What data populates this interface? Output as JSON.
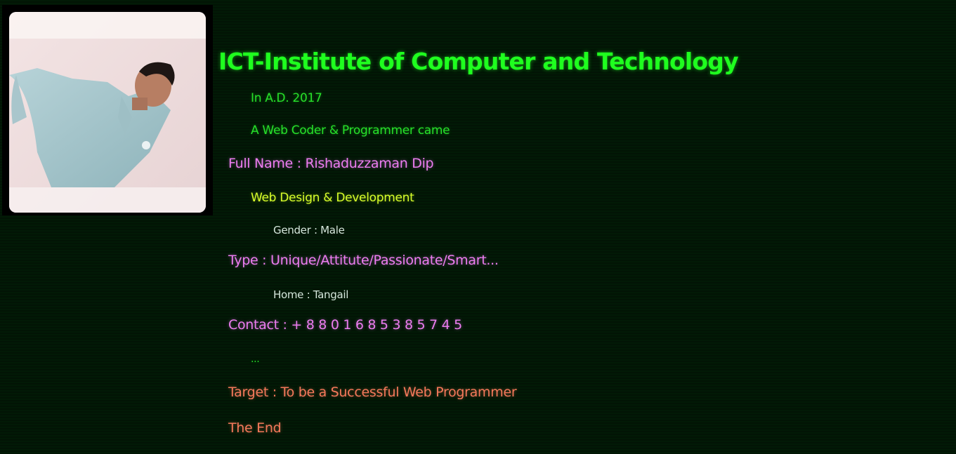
{
  "profile": {
    "photo_icon": "person-portrait-photo",
    "title": "ICT-Institute of Computer and Technology",
    "year_line": "In A.D. 2017",
    "intro_line": "A Web Coder & Programmer came",
    "full_name": "Full Name : Rishaduzzaman Dip",
    "profession": "Web Design & Development",
    "gender": "Gender : Male",
    "type": "Type : Unique/Attitute/Passionate/Smart...",
    "home": "Home : Tangail",
    "contact": "Contact : + 8 8 0 1 6 8 5 3 8 5 7 4 5",
    "ellipsis": "...",
    "target": "Target : To be a Successful Web Programmer",
    "end": "The End"
  },
  "colors": {
    "background": "#021a06",
    "title": "#1fff1f",
    "green_text": "#27e02a",
    "violet_text": "#ec7df0",
    "yellow_text": "#d8ff2a",
    "pale_text": "#d6e6dc",
    "coral_text": "#f4795a"
  }
}
